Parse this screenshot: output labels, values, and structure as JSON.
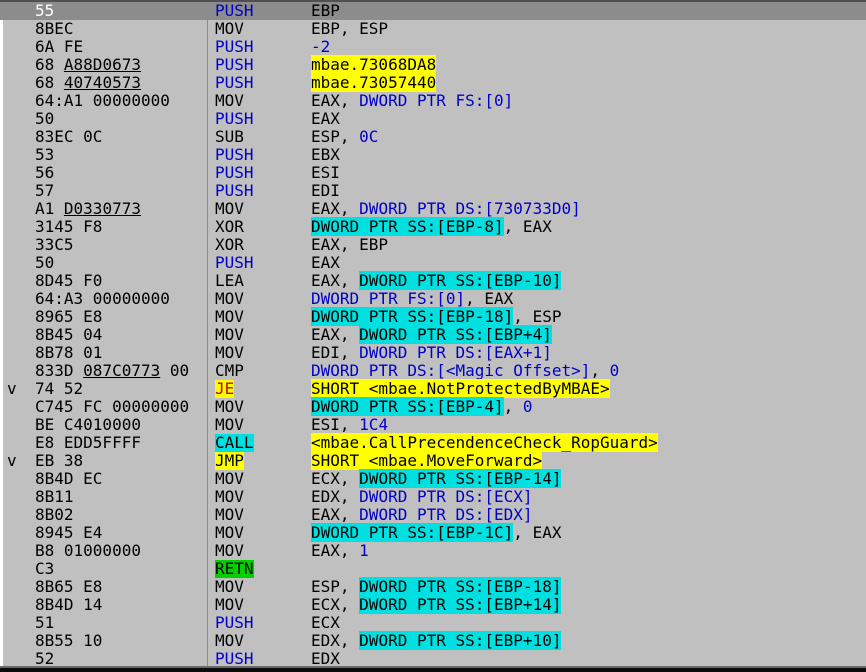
{
  "disassembly": {
    "rows": [
      {
        "marker": "",
        "hex": [
          {
            "t": "55"
          }
        ],
        "mnemonic": "PUSH",
        "mkind": "push",
        "ops": [
          {
            "t": "EBP",
            "k": "plain"
          }
        ],
        "selected": true
      },
      {
        "marker": "",
        "hex": [
          {
            "t": "8BEC"
          }
        ],
        "mnemonic": "MOV",
        "mkind": "",
        "ops": [
          {
            "t": "EBP, ESP",
            "k": "plain"
          }
        ]
      },
      {
        "marker": "",
        "hex": [
          {
            "t": "6A FE"
          }
        ],
        "mnemonic": "PUSH",
        "mkind": "push",
        "ops": [
          {
            "t": "-2",
            "k": "imm"
          }
        ]
      },
      {
        "marker": "",
        "hex": [
          {
            "t": "68 "
          },
          {
            "t": "A88D0673",
            "u": true
          }
        ],
        "mnemonic": "PUSH",
        "mkind": "push",
        "ops": [
          {
            "t": "mbae.73068DA8",
            "k": "hlY"
          }
        ]
      },
      {
        "marker": "",
        "hex": [
          {
            "t": "68 "
          },
          {
            "t": "40740573",
            "u": true
          }
        ],
        "mnemonic": "PUSH",
        "mkind": "push",
        "ops": [
          {
            "t": "mbae.73057440",
            "k": "hlY"
          }
        ]
      },
      {
        "marker": "",
        "hex": [
          {
            "t": "64:A1 00000000"
          }
        ],
        "mnemonic": "MOV",
        "mkind": "",
        "ops": [
          {
            "t": "EAX, ",
            "k": "plain"
          },
          {
            "t": "DWORD PTR FS:[0]",
            "k": "mem"
          }
        ]
      },
      {
        "marker": "",
        "hex": [
          {
            "t": "50"
          }
        ],
        "mnemonic": "PUSH",
        "mkind": "push",
        "ops": [
          {
            "t": "EAX",
            "k": "plain"
          }
        ]
      },
      {
        "marker": "",
        "hex": [
          {
            "t": "83EC 0C"
          }
        ],
        "mnemonic": "SUB",
        "mkind": "",
        "ops": [
          {
            "t": "ESP, ",
            "k": "plain"
          },
          {
            "t": "0C",
            "k": "imm"
          }
        ]
      },
      {
        "marker": "",
        "hex": [
          {
            "t": "53"
          }
        ],
        "mnemonic": "PUSH",
        "mkind": "push",
        "ops": [
          {
            "t": "EBX",
            "k": "plain"
          }
        ]
      },
      {
        "marker": "",
        "hex": [
          {
            "t": "56"
          }
        ],
        "mnemonic": "PUSH",
        "mkind": "push",
        "ops": [
          {
            "t": "ESI",
            "k": "plain"
          }
        ]
      },
      {
        "marker": "",
        "hex": [
          {
            "t": "57"
          }
        ],
        "mnemonic": "PUSH",
        "mkind": "push",
        "ops": [
          {
            "t": "EDI",
            "k": "plain"
          }
        ]
      },
      {
        "marker": "",
        "hex": [
          {
            "t": "A1 "
          },
          {
            "t": "D0330773",
            "u": true
          }
        ],
        "mnemonic": "MOV",
        "mkind": "",
        "ops": [
          {
            "t": "EAX, ",
            "k": "plain"
          },
          {
            "t": "DWORD PTR DS:[730733D0]",
            "k": "mem"
          }
        ]
      },
      {
        "marker": "",
        "hex": [
          {
            "t": "3145 F8"
          }
        ],
        "mnemonic": "XOR",
        "mkind": "",
        "ops": [
          {
            "t": "DWORD PTR SS:[EBP-8]",
            "k": "memhl"
          },
          {
            "t": ", EAX",
            "k": "plain"
          }
        ]
      },
      {
        "marker": "",
        "hex": [
          {
            "t": "33C5"
          }
        ],
        "mnemonic": "XOR",
        "mkind": "",
        "ops": [
          {
            "t": "EAX, EBP",
            "k": "plain"
          }
        ]
      },
      {
        "marker": "",
        "hex": [
          {
            "t": "50"
          }
        ],
        "mnemonic": "PUSH",
        "mkind": "push",
        "ops": [
          {
            "t": "EAX",
            "k": "plain"
          }
        ]
      },
      {
        "marker": "",
        "hex": [
          {
            "t": "8D45 F0"
          }
        ],
        "mnemonic": "LEA",
        "mkind": "",
        "ops": [
          {
            "t": "EAX, ",
            "k": "plain"
          },
          {
            "t": "DWORD PTR SS:[EBP-10]",
            "k": "memhl"
          }
        ]
      },
      {
        "marker": "",
        "hex": [
          {
            "t": "64:A3 00000000"
          }
        ],
        "mnemonic": "MOV",
        "mkind": "",
        "ops": [
          {
            "t": "DWORD PTR FS:[0]",
            "k": "mem"
          },
          {
            "t": ", EAX",
            "k": "plain"
          }
        ]
      },
      {
        "marker": "",
        "hex": [
          {
            "t": "8965 E8"
          }
        ],
        "mnemonic": "MOV",
        "mkind": "",
        "ops": [
          {
            "t": "DWORD PTR SS:[EBP-18]",
            "k": "memhl"
          },
          {
            "t": ", ESP",
            "k": "plain"
          }
        ]
      },
      {
        "marker": "",
        "hex": [
          {
            "t": "8B45 04"
          }
        ],
        "mnemonic": "MOV",
        "mkind": "",
        "ops": [
          {
            "t": "EAX, ",
            "k": "plain"
          },
          {
            "t": "DWORD PTR SS:[EBP+4]",
            "k": "memhl"
          }
        ]
      },
      {
        "marker": "",
        "hex": [
          {
            "t": "8B78 01"
          }
        ],
        "mnemonic": "MOV",
        "mkind": "",
        "ops": [
          {
            "t": "EDI, ",
            "k": "plain"
          },
          {
            "t": "DWORD PTR DS:[EAX+1]",
            "k": "mem"
          }
        ]
      },
      {
        "marker": "",
        "hex": [
          {
            "t": "833D "
          },
          {
            "t": "087C0773",
            "u": true
          },
          {
            "t": " 00"
          }
        ],
        "mnemonic": "CMP",
        "mkind": "",
        "ops": [
          {
            "t": "DWORD PTR DS:[<Magic_Offset>]",
            "k": "mem"
          },
          {
            "t": ", ",
            "k": "plain"
          },
          {
            "t": "0",
            "k": "imm"
          }
        ]
      },
      {
        "marker": "v",
        "hex": [
          {
            "t": "74 52"
          }
        ],
        "mnemonic": "JE",
        "mkind": "jcc",
        "ops": [
          {
            "t": "SHORT <mbae.NotProtectedByMBAE>",
            "k": "hlY"
          }
        ]
      },
      {
        "marker": "",
        "hex": [
          {
            "t": "C745 FC 00000000"
          }
        ],
        "mnemonic": "MOV",
        "mkind": "",
        "ops": [
          {
            "t": "DWORD PTR SS:[EBP-4]",
            "k": "memhl"
          },
          {
            "t": ", ",
            "k": "plain"
          },
          {
            "t": "0",
            "k": "imm"
          }
        ]
      },
      {
        "marker": "",
        "hex": [
          {
            "t": "BE C4010000"
          }
        ],
        "mnemonic": "MOV",
        "mkind": "",
        "ops": [
          {
            "t": "ESI, ",
            "k": "plain"
          },
          {
            "t": "1C4",
            "k": "imm"
          }
        ]
      },
      {
        "marker": "",
        "hex": [
          {
            "t": "E8 EDD5FFFF"
          }
        ],
        "mnemonic": "CALL",
        "mkind": "call",
        "ops": [
          {
            "t": "<mbae.CallPrecendenceCheck_RopGuard>",
            "k": "hlY"
          }
        ]
      },
      {
        "marker": "v",
        "hex": [
          {
            "t": "EB 38"
          }
        ],
        "mnemonic": "JMP",
        "mkind": "jmp",
        "ops": [
          {
            "t": "SHORT <mbae.MoveForward>",
            "k": "hlY"
          }
        ]
      },
      {
        "marker": "",
        "hex": [
          {
            "t": "8B4D EC"
          }
        ],
        "mnemonic": "MOV",
        "mkind": "",
        "ops": [
          {
            "t": "ECX, ",
            "k": "plain"
          },
          {
            "t": "DWORD PTR SS:[EBP-14]",
            "k": "memhl"
          }
        ]
      },
      {
        "marker": "",
        "hex": [
          {
            "t": "8B11"
          }
        ],
        "mnemonic": "MOV",
        "mkind": "",
        "ops": [
          {
            "t": "EDX, ",
            "k": "plain"
          },
          {
            "t": "DWORD PTR DS:[ECX]",
            "k": "mem"
          }
        ]
      },
      {
        "marker": "",
        "hex": [
          {
            "t": "8B02"
          }
        ],
        "mnemonic": "MOV",
        "mkind": "",
        "ops": [
          {
            "t": "EAX, ",
            "k": "plain"
          },
          {
            "t": "DWORD PTR DS:[EDX]",
            "k": "mem"
          }
        ]
      },
      {
        "marker": "",
        "hex": [
          {
            "t": "8945 E4"
          }
        ],
        "mnemonic": "MOV",
        "mkind": "",
        "ops": [
          {
            "t": "DWORD PTR SS:[EBP-1C]",
            "k": "memhl"
          },
          {
            "t": ", EAX",
            "k": "plain"
          }
        ]
      },
      {
        "marker": "",
        "hex": [
          {
            "t": "B8 01000000"
          }
        ],
        "mnemonic": "MOV",
        "mkind": "",
        "ops": [
          {
            "t": "EAX, ",
            "k": "plain"
          },
          {
            "t": "1",
            "k": "imm"
          }
        ]
      },
      {
        "marker": "",
        "hex": [
          {
            "t": "C3"
          }
        ],
        "mnemonic": "RETN",
        "mkind": "ret",
        "ops": []
      },
      {
        "marker": "",
        "hex": [
          {
            "t": "8B65 E8"
          }
        ],
        "mnemonic": "MOV",
        "mkind": "",
        "ops": [
          {
            "t": "ESP, ",
            "k": "plain"
          },
          {
            "t": "DWORD PTR SS:[EBP-18]",
            "k": "memhl"
          }
        ]
      },
      {
        "marker": "",
        "hex": [
          {
            "t": "8B4D 14"
          }
        ],
        "mnemonic": "MOV",
        "mkind": "",
        "ops": [
          {
            "t": "ECX, ",
            "k": "plain"
          },
          {
            "t": "DWORD PTR SS:[EBP+14]",
            "k": "memhl"
          }
        ]
      },
      {
        "marker": "",
        "hex": [
          {
            "t": "51"
          }
        ],
        "mnemonic": "PUSH",
        "mkind": "push",
        "ops": [
          {
            "t": "ECX",
            "k": "plain"
          }
        ]
      },
      {
        "marker": "",
        "hex": [
          {
            "t": "8B55 10"
          }
        ],
        "mnemonic": "MOV",
        "mkind": "",
        "ops": [
          {
            "t": "EDX, ",
            "k": "plain"
          },
          {
            "t": "DWORD PTR SS:[EBP+10]",
            "k": "memhl"
          }
        ]
      },
      {
        "marker": "",
        "hex": [
          {
            "t": "52"
          }
        ],
        "mnemonic": "PUSH",
        "mkind": "push",
        "ops": [
          {
            "t": "EDX",
            "k": "plain"
          }
        ]
      }
    ]
  }
}
